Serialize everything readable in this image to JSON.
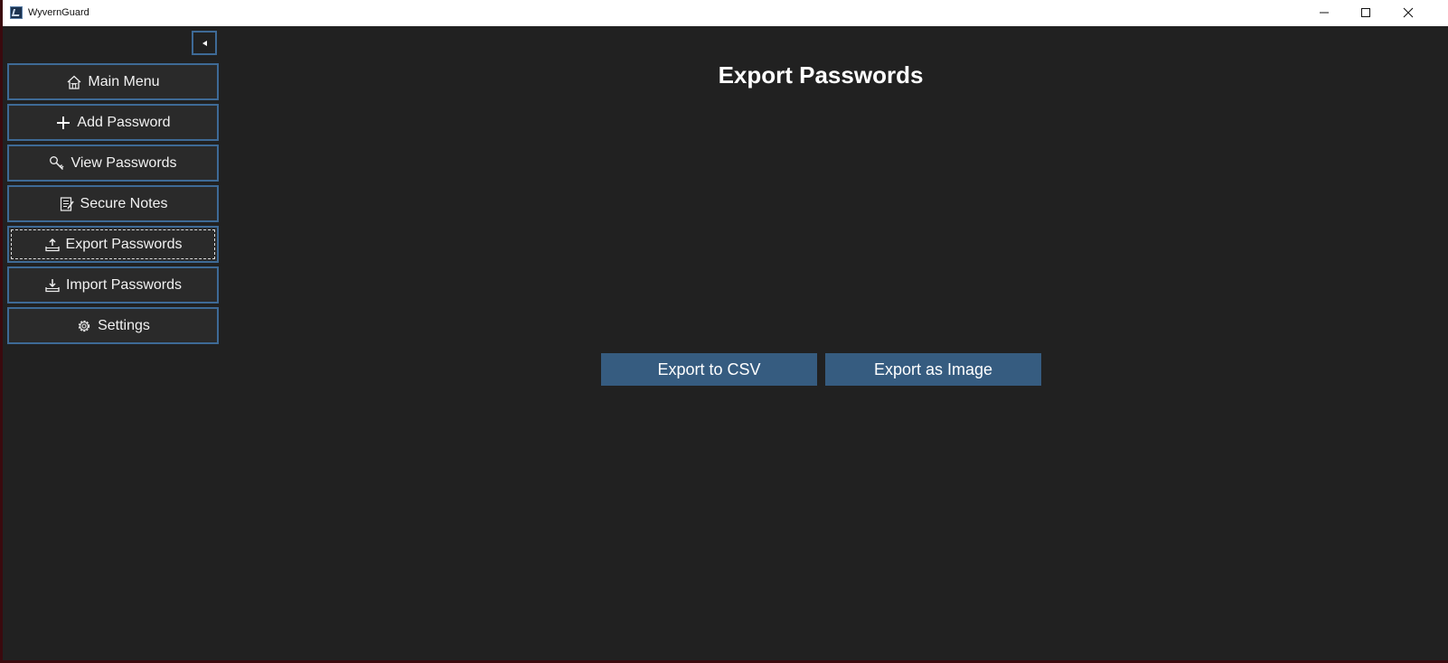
{
  "window": {
    "title": "WyvernGuard"
  },
  "sidebar": {
    "collapse_icon": "triangle-left-icon",
    "items": [
      {
        "label": "Main Menu",
        "icon": "home-icon"
      },
      {
        "label": "Add Password",
        "icon": "plus-icon"
      },
      {
        "label": "View Passwords",
        "icon": "key-icon"
      },
      {
        "label": "Secure Notes",
        "icon": "notes-icon"
      },
      {
        "label": "Export Passwords",
        "icon": "export-icon",
        "focused": true
      },
      {
        "label": "Import Passwords",
        "icon": "import-icon"
      },
      {
        "label": "Settings",
        "icon": "gear-icon"
      }
    ]
  },
  "main": {
    "title": "Export Passwords",
    "buttons": {
      "csv": "Export to CSV",
      "image": "Export as Image"
    }
  },
  "colors": {
    "background": "#212121",
    "nav_border": "#3e6a96",
    "button": "#365c80",
    "text": "#ffffff"
  }
}
